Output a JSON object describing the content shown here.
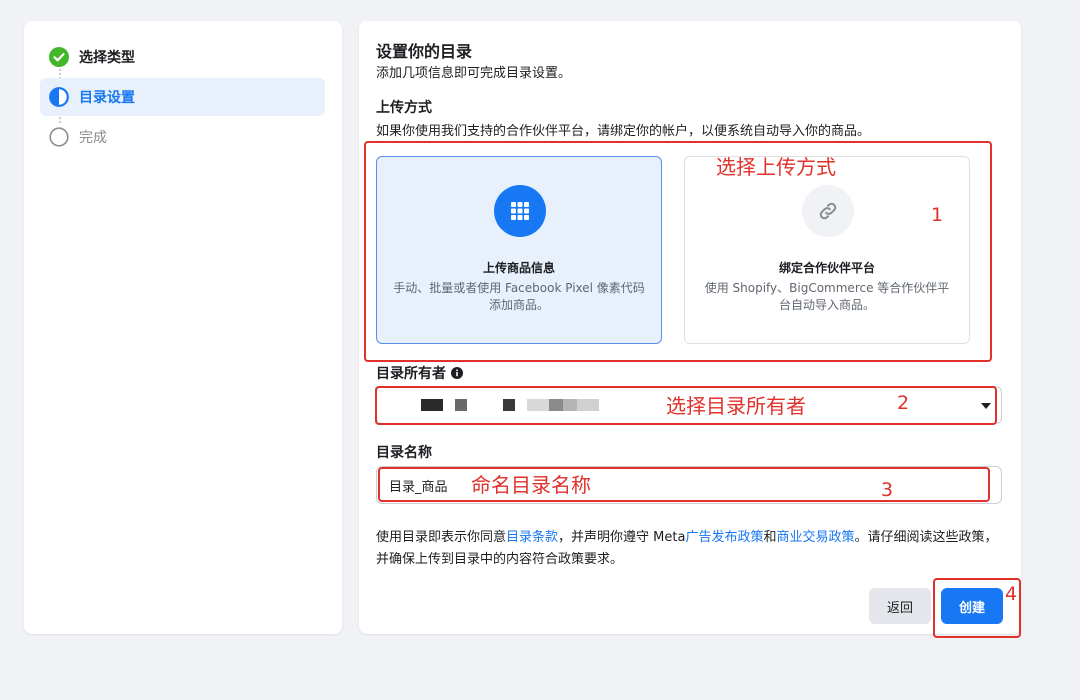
{
  "steps": [
    {
      "label": "选择类型",
      "state": "done"
    },
    {
      "label": "目录设置",
      "state": "active"
    },
    {
      "label": "完成",
      "state": "pending"
    }
  ],
  "main": {
    "title": "设置你的目录",
    "subtitle": "添加几项信息即可完成目录设置。",
    "upload_label": "上传方式",
    "upload_desc": "如果你使用我们支持的合作伙伴平台，请绑定你的帐户，以便系统自动导入你的商品。",
    "options": [
      {
        "title": "上传商品信息",
        "desc": "手动、批量或者使用 Facebook Pixel 像素代码添加商品。",
        "icon": "grid-icon",
        "selected": true
      },
      {
        "title": "绑定合作伙伴平台",
        "desc": "使用 Shopify、BigCommerce 等合作伙伴平台自动导入商品。",
        "icon": "link-icon",
        "selected": false
      }
    ],
    "owner_label": "目录所有者",
    "name_label": "目录名称",
    "name_value": "目录_商品",
    "policy": {
      "t1": "使用目录即表示你同意",
      "link1": "目录条款",
      "t2": "，并声明你遵守 Meta",
      "link2": "广告发布政策",
      "t3": "和",
      "link3": "商业交易政策",
      "t4": "。请仔细阅读这些政策，并确保上传到目录中的内容符合政策要求。"
    },
    "back_label": "返回",
    "create_label": "创建"
  },
  "annotations": [
    {
      "text": "选择上传方式",
      "num": "1"
    },
    {
      "text": "选择目录所有者",
      "num": "2"
    },
    {
      "text": "命名目录名称",
      "num": "3"
    },
    {
      "num": "4"
    }
  ],
  "colors": {
    "accent": "#1877f2",
    "annotation": "#e0312b",
    "done": "#42b72a"
  }
}
